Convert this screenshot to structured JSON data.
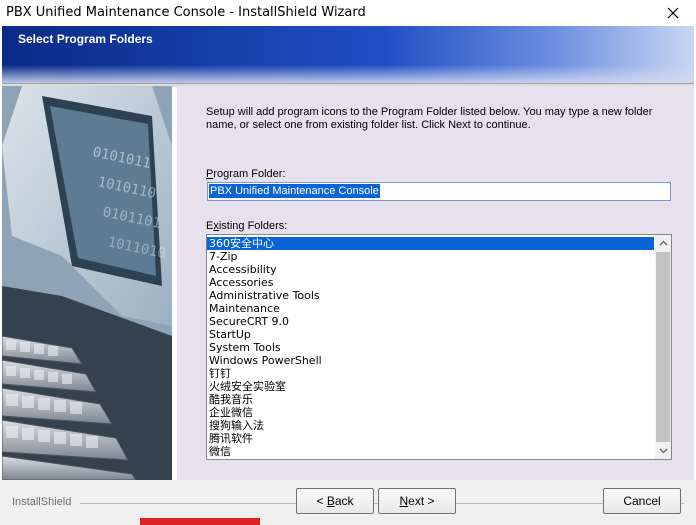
{
  "window": {
    "title": "PBX Unified Maintenance Console - InstallShield Wizard",
    "close_glyph": "✕"
  },
  "banner": {
    "heading": "Select Program Folders"
  },
  "graphic": {
    "binary_text": "01010110101 1010110101 0101101011 101010110 010110101 01011010 1011010 0101101"
  },
  "main": {
    "intro": "Setup will add program icons to the Program Folder listed below. You may type a new folder name, or select one from existing folder list. Click Next to continue.",
    "program_folder_label": "Program Folder:",
    "program_folder_accesskey": "P",
    "program_folder_rest": "rogram Folder:",
    "program_folder_value": "PBX Unified Maintenance Console",
    "existing_label_accesskey": "x",
    "existing_label_first": "E",
    "existing_label_rest": "isting Folders:",
    "existing_folders": [
      "360安全中心",
      "7-Zip",
      "Accessibility",
      "Accessories",
      "Administrative Tools",
      "Maintenance",
      "SecureCRT 9.0",
      "StartUp",
      "System Tools",
      "Windows PowerShell",
      "钉钉",
      "火绒安全实验室",
      "酷我音乐",
      "企业微信",
      "搜狗输入法",
      "腾讯软件",
      "微信"
    ],
    "selected_index": 0
  },
  "footer": {
    "brand": "InstallShield",
    "back_prefix": "< ",
    "back_accesskey": "B",
    "back_rest": "ack",
    "next_accesskey": "N",
    "next_rest": "ext >",
    "cancel_label": "Cancel"
  },
  "colors": {
    "selection": "#0a64d8",
    "banner_dark": "#0a2a86",
    "panel_bg": "#e6e1ec"
  }
}
